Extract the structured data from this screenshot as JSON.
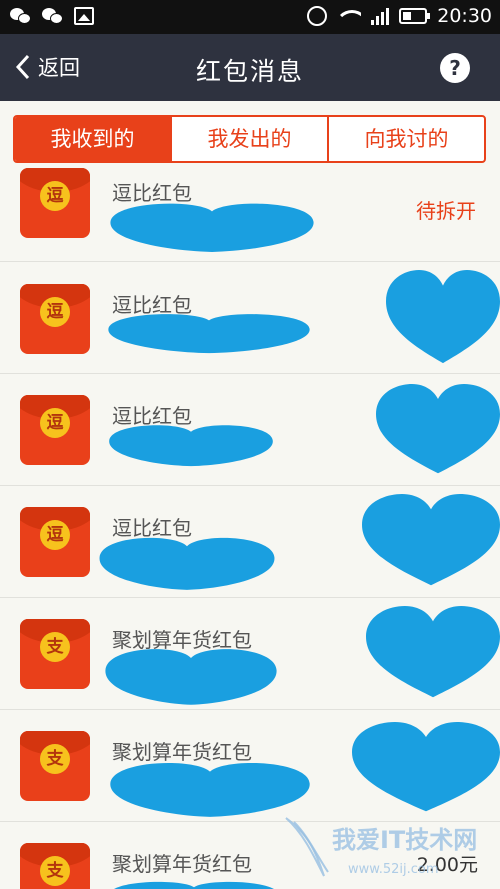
{
  "status_bar": {
    "time": "20:30"
  },
  "nav": {
    "back_label": "返回",
    "title": "红包消息",
    "help_label": "?"
  },
  "tabs": [
    {
      "label": "我收到的",
      "active": true
    },
    {
      "label": "我发出的",
      "active": false
    },
    {
      "label": "向我讨的",
      "active": false
    }
  ],
  "items": [
    {
      "icon_char": "逗",
      "title": "逗比红包",
      "status": "待拆开"
    },
    {
      "icon_char": "逗",
      "title": "逗比红包"
    },
    {
      "icon_char": "逗",
      "title": "逗比红包"
    },
    {
      "icon_char": "逗",
      "title": "逗比红包"
    },
    {
      "icon_char": "支",
      "title": "聚划算年货红包"
    },
    {
      "icon_char": "支",
      "title": "聚划算年货红包"
    },
    {
      "icon_char": "支",
      "title": "聚划算年货红包",
      "amount": "2.00元"
    }
  ],
  "watermark": {
    "text": "我爱IT技术网",
    "url": "www.52ij.com"
  },
  "colors": {
    "accent": "#e8411a",
    "nav_bg": "#2e323f",
    "redaction": "#1a9fe0"
  }
}
